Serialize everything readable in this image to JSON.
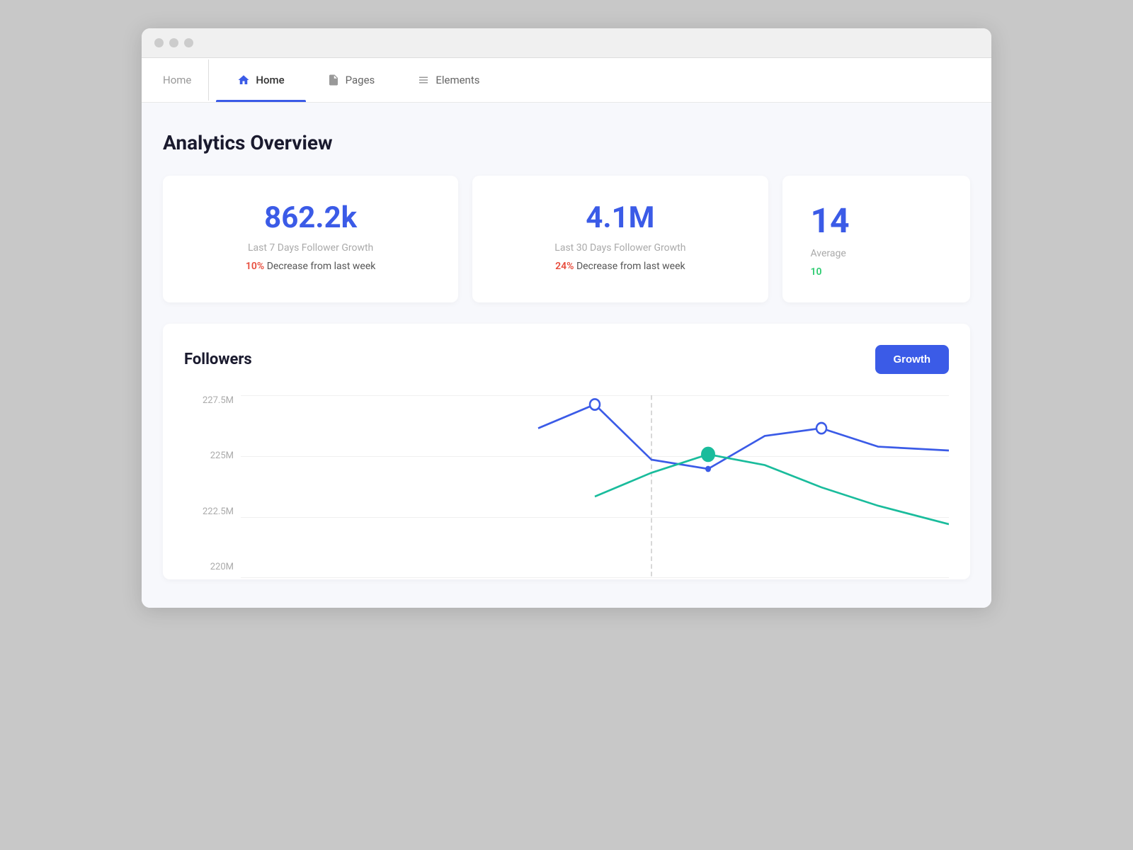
{
  "browser": {
    "dots": [
      "dot1",
      "dot2",
      "dot3"
    ]
  },
  "nav": {
    "breadcrumb": "Home",
    "tabs": [
      {
        "label": "Home",
        "icon": "home-icon",
        "active": true
      },
      {
        "label": "Pages",
        "icon": "pages-icon",
        "active": false
      },
      {
        "label": "Elements",
        "icon": "elements-icon",
        "active": false
      }
    ]
  },
  "page": {
    "title": "Analytics Overview"
  },
  "stats": [
    {
      "value": "862.2k",
      "label": "Last 7 Days Follower Growth",
      "change_pct": "10%",
      "change_type": "decrease",
      "change_text": "Decrease from last week"
    },
    {
      "value": "4.1M",
      "label": "Last 30 Days Follower Growth",
      "change_pct": "24%",
      "change_type": "decrease",
      "change_text": "Decrease from last week"
    },
    {
      "value": "14",
      "label": "Average",
      "change_pct": "10",
      "change_type": "increase",
      "change_text": ""
    }
  ],
  "chart": {
    "title": "Followers",
    "button_label": "Growth",
    "y_labels": [
      "227.5M",
      "225M",
      "222.5M",
      "220M"
    ],
    "blue_line": [
      {
        "x": 0.42,
        "y": 0.18
      },
      {
        "x": 0.5,
        "y": 0.05
      },
      {
        "x": 0.58,
        "y": 0.35
      },
      {
        "x": 0.66,
        "y": 0.4
      },
      {
        "x": 0.74,
        "y": 0.22
      },
      {
        "x": 0.82,
        "y": 0.18
      },
      {
        "x": 0.9,
        "y": 0.28
      },
      {
        "x": 1.0,
        "y": 0.3
      }
    ],
    "teal_line": [
      {
        "x": 0.5,
        "y": 0.55
      },
      {
        "x": 0.58,
        "y": 0.42
      },
      {
        "x": 0.66,
        "y": 0.32
      },
      {
        "x": 0.74,
        "y": 0.38
      },
      {
        "x": 0.82,
        "y": 0.5
      },
      {
        "x": 0.9,
        "y": 0.6
      },
      {
        "x": 1.0,
        "y": 0.7
      }
    ]
  }
}
